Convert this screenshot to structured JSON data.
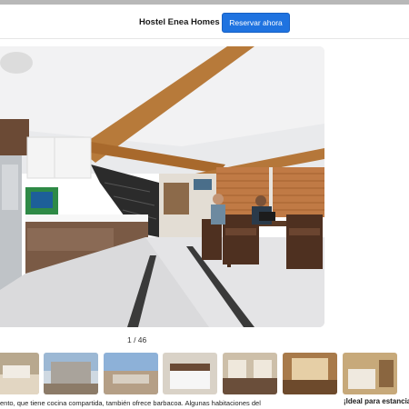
{
  "header": {
    "hostel_name": "Hostel Enea Homes",
    "reserve_button": "Reservar ahora"
  },
  "gallery": {
    "counter": "1 / 46",
    "thumbnail_count": 7
  },
  "description": {
    "text": "ento, que tiene cocina compartida, también ofrece barbacoa. Algunas habitaciones del",
    "side_heading": "¡Ideal para estancia"
  },
  "colors": {
    "accent": "#1f73e0",
    "header_bg": "#ffffff",
    "top_strip": "#b8b8b8"
  }
}
